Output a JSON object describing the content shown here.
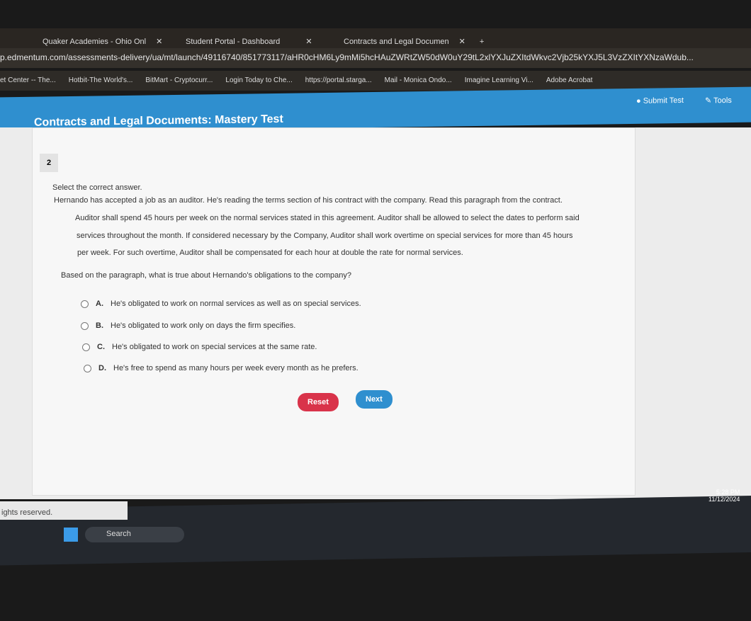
{
  "browser": {
    "tabs": [
      {
        "label": "Quaker Academies - Ohio Onl"
      },
      {
        "label": "Student Portal - Dashboard"
      },
      {
        "label": "Contracts and Legal Documen"
      }
    ],
    "url": "p.edmentum.com/assessments-delivery/ua/mt/launch/49116740/851773117/aHR0cHM6Ly9mMi5hcHAuZWRtZW50dW0uY29tL2xlYXJuZXItdWkvc2Vjb25kYXJ5L3VzZXItYXNzaWdub...",
    "bookmarks": [
      "et Center -- The...",
      "Hotbit-The World's...",
      "BitMart - Cryptocurr...",
      "Login Today to Che...",
      "https://portal.starga...",
      "Mail - Monica Ondo...",
      "Imagine Learning Vi...",
      "Adobe Acrobat"
    ]
  },
  "header": {
    "title": "Contracts and Legal Documents: Mastery Test",
    "submit": "Submit Test",
    "tools": "Tools",
    "color": "#2f8fcf"
  },
  "question": {
    "number": "2",
    "instruction": "Select the correct answer.",
    "intro": "Hernando has accepted a job as an auditor. He's reading the terms section of his contract with the company. Read this paragraph from the contract.",
    "passage": [
      "Auditor shall spend 45 hours per week on the normal services stated in this agreement. Auditor shall be allowed to select the dates to perform said",
      "services throughout the month. If considered necessary by the Company, Auditor shall work overtime on special services for more than 45 hours",
      "per week. For such overtime, Auditor shall be compensated for each hour at double the rate for normal services."
    ],
    "prompt": "Based on the paragraph, what is true about Hernando's obligations to the company?",
    "options": [
      {
        "letter": "A.",
        "text": "He's obligated to work on normal services as well as on special services."
      },
      {
        "letter": "B.",
        "text": "He's obligated to work only on days the firm specifies."
      },
      {
        "letter": "C.",
        "text": "He's obligated to work on special services at the same rate."
      },
      {
        "letter": "D.",
        "text": "He's free to spend as many hours per week every month as he prefers."
      }
    ]
  },
  "buttons": {
    "reset": "Reset",
    "next": "Next",
    "reset_color": "#d9334a",
    "next_color": "#2f8fcf"
  },
  "footer": "ights reserved.",
  "taskbar": {
    "search": "Search",
    "time": "5:28 PM",
    "date": "11/12/2024"
  }
}
